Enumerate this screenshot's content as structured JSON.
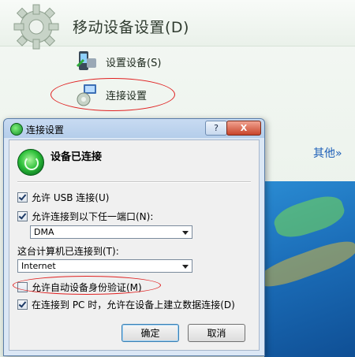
{
  "background": {
    "title": "移动设备设置(D)",
    "items": [
      {
        "label": "设置设备(S)",
        "icon": "phone-setup-icon"
      },
      {
        "label": "连接设置",
        "icon": "connection-settings-icon"
      }
    ],
    "more_label": "其他",
    "more_chevron": "»"
  },
  "dialog": {
    "title": "连接设置",
    "help_label": "?",
    "close_label": "X",
    "status_text": "设备已连接",
    "usb_option": {
      "label": "允许 USB 连接(U)",
      "checked": true
    },
    "port_option": {
      "label": "允许连接到以下任一端口(N):",
      "checked": true
    },
    "port_value": "DMA",
    "network_label": "这台计算机已连接到(T):",
    "network_value": "Internet",
    "auth_option": {
      "label": "允许自动设备身份验证(M)",
      "checked": false
    },
    "data_conn_option": {
      "label": "在连接到 PC 时，允许在设备上建立数据连接(D)",
      "checked": true
    },
    "ok_label": "确定",
    "cancel_label": "取消"
  },
  "colors": {
    "highlight_ellipse": "#e02020",
    "link": "#1d5fb8",
    "status_green": "#2fc13b"
  }
}
